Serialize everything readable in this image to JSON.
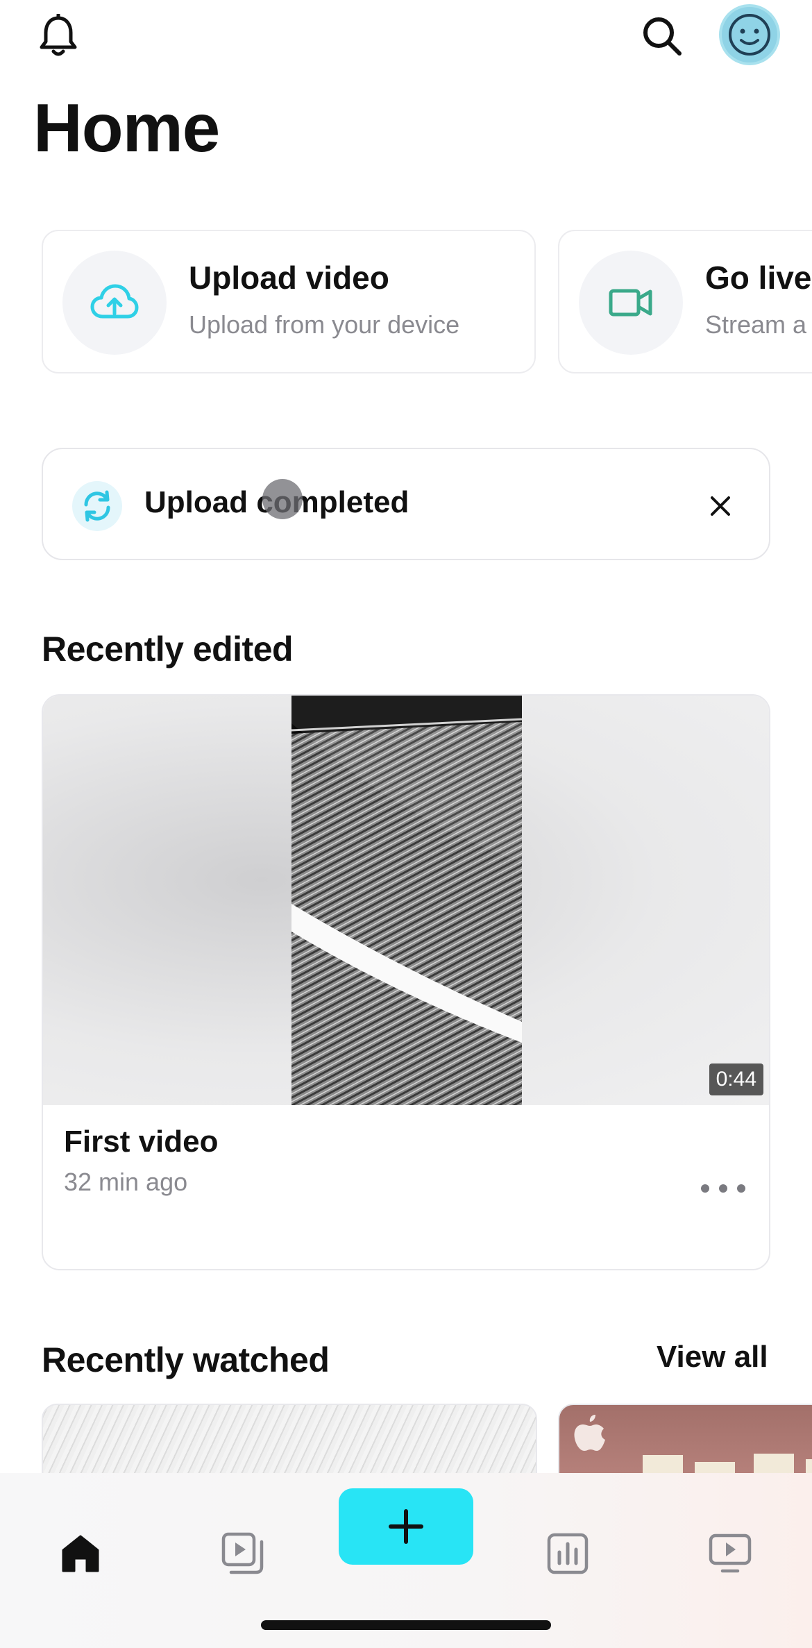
{
  "header": {
    "title": "Home",
    "icons": [
      "bell-icon",
      "search-icon",
      "avatar-icon"
    ]
  },
  "actions": [
    {
      "title": "Upload video",
      "subtitle": "Upload from your device",
      "icon": "cloud-upload-icon",
      "icon_color": "#2fd0e6"
    },
    {
      "title": "Go live",
      "subtitle": "Stream a",
      "icon": "video-camera-icon",
      "icon_color": "#3aa98a"
    }
  ],
  "banner": {
    "message": "Upload completed",
    "icon": "sync-icon",
    "close_icon": "close-icon"
  },
  "recently_edited": {
    "title": "Recently edited",
    "video": {
      "title": "First video",
      "meta": "32 min ago",
      "duration": "0:44"
    }
  },
  "recently_watched": {
    "title": "Recently watched",
    "view_all": "View all"
  },
  "nav": {
    "items": [
      "home-icon",
      "videos-icon",
      "create-icon",
      "analytics-icon",
      "watch-icon"
    ],
    "accent": "#28e4f5"
  }
}
